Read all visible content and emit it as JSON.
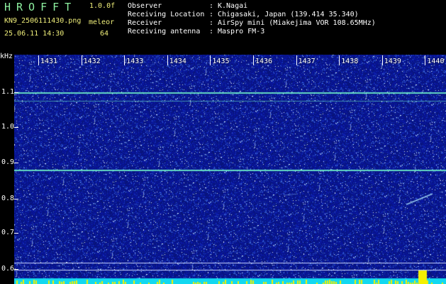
{
  "header": {
    "app_title": "HROFFT",
    "version": "1.0.0f",
    "filename": "KN9_2506111430.png",
    "mode": "meleor",
    "datetime": "25.06.11 14:30",
    "number": "64",
    "info": [
      {
        "key": "Observer",
        "value": "K.Nagai"
      },
      {
        "key": "Receiving Location",
        "value": "Chigasaki, Japan (139.414 35.340)"
      },
      {
        "key": "Receiver",
        "value": "AirSpy mini (Miakejima VOR 108.65MHz)"
      },
      {
        "key": "Receiving antenna",
        "value": "Maspro FM-3"
      }
    ]
  },
  "axes": {
    "y_unit": "kHz",
    "y_labels": [
      "1.1",
      "1.0",
      "0.9",
      "0.8",
      "0.7",
      "0.6"
    ],
    "x_labels": [
      "1431",
      "1432",
      "1433",
      "1434",
      "1435",
      "1436",
      "1437",
      "1438",
      "1439",
      "1440"
    ]
  },
  "colors": {
    "background": "#0a1a8c",
    "signal_line": "#6ef0c8",
    "trace": "#b8f4ff",
    "bottom_band": "#12d8f0",
    "bottom_peaks": "#f4f000"
  }
}
